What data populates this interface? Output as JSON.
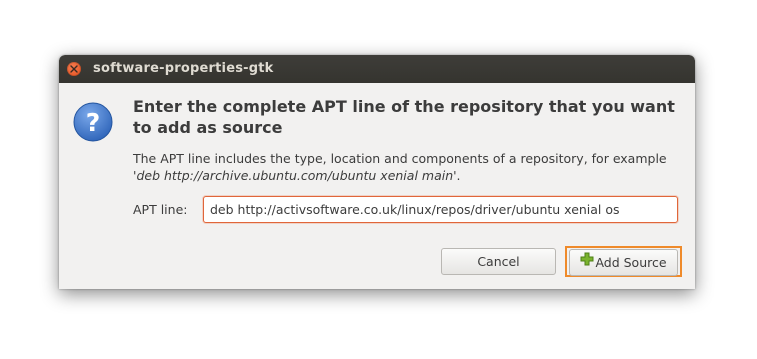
{
  "window": {
    "title": "software-properties-gtk"
  },
  "dialog": {
    "heading": "Enter the complete APT line of the repository that you want to add as source",
    "description_prefix": "The APT line includes the type, location and components of a repository, for example  '",
    "description_example": "deb http://archive.ubuntu.com/ubuntu xenial main",
    "description_suffix": "'.",
    "apt_label": "APT line:",
    "apt_value": "deb http://activsoftware.co.uk/linux/repos/driver/ubuntu xenial os",
    "icon": "question-icon"
  },
  "buttons": {
    "cancel": "Cancel",
    "add_source": "Add Source",
    "add_source_icon": "plus-icon"
  },
  "colors": {
    "close_button": "#e5501d",
    "highlight": "#ef8a2a",
    "input_focus": "#e0663a",
    "icon_blue": "#3f77c9",
    "plus_green": "#7ab32e"
  }
}
